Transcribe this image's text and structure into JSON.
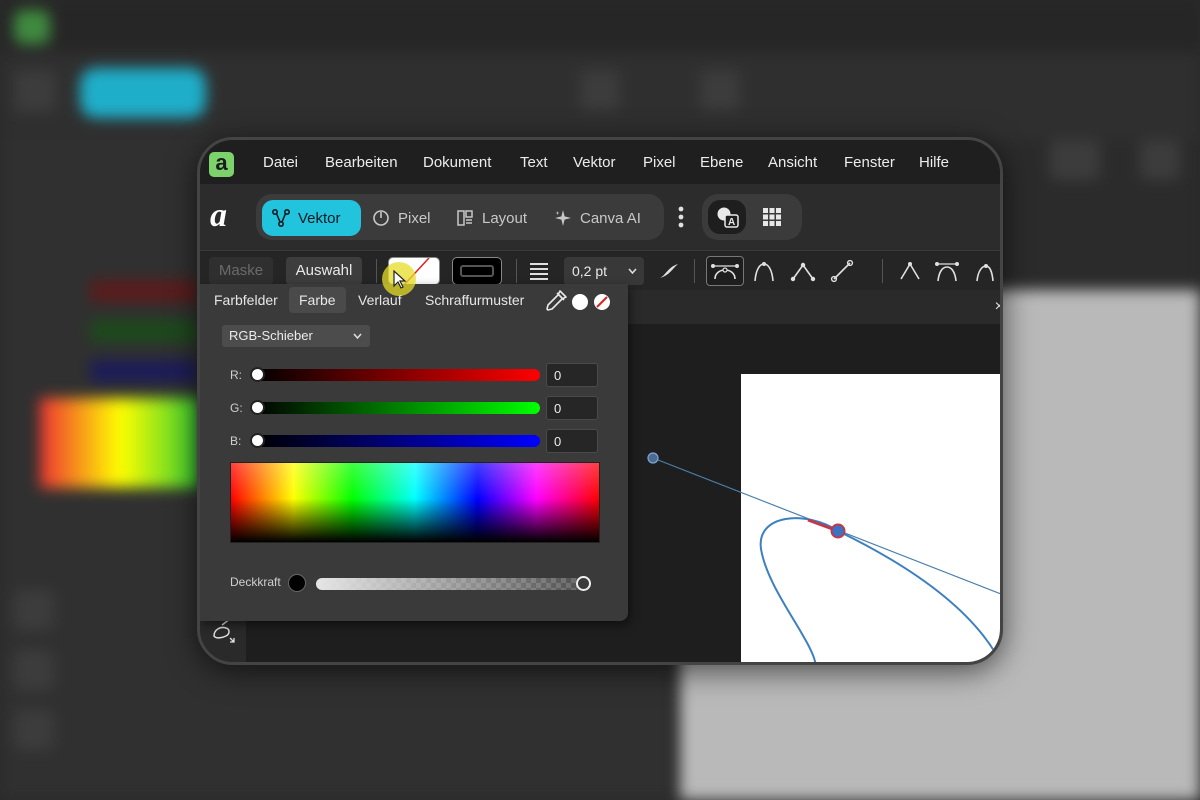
{
  "menu": {
    "items": [
      "Datei",
      "Bearbeiten",
      "Dokument",
      "Text",
      "Vektor",
      "Pixel",
      "Ebene",
      "Ansicht",
      "Fenster",
      "Hilfe"
    ]
  },
  "toolbar": {
    "personas": [
      {
        "label": "Vektor",
        "icon": "vector-persona-icon",
        "active": true
      },
      {
        "label": "Pixel",
        "icon": "pixel-persona-icon",
        "active": false
      },
      {
        "label": "Layout",
        "icon": "layout-persona-icon",
        "active": false
      },
      {
        "label": "Canva AI",
        "icon": "sparkle-icon",
        "active": false
      }
    ],
    "accent_color": "#22c3dd"
  },
  "context": {
    "mask_label": "Maske",
    "selection_label": "Auswahl",
    "stroke_width": "0,2 pt"
  },
  "color_panel": {
    "tabs": [
      "Farbfelder",
      "Farbe",
      "Verlauf",
      "Schraffurmuster"
    ],
    "active_tab": "Farbe",
    "mode": "RGB-Schieber",
    "sliders": [
      {
        "label": "R:",
        "value": "0"
      },
      {
        "label": "G:",
        "value": "0"
      },
      {
        "label": "B:",
        "value": "0"
      }
    ],
    "opacity_label": "Deckkraft"
  },
  "document": {
    "close_symbol": "×"
  }
}
